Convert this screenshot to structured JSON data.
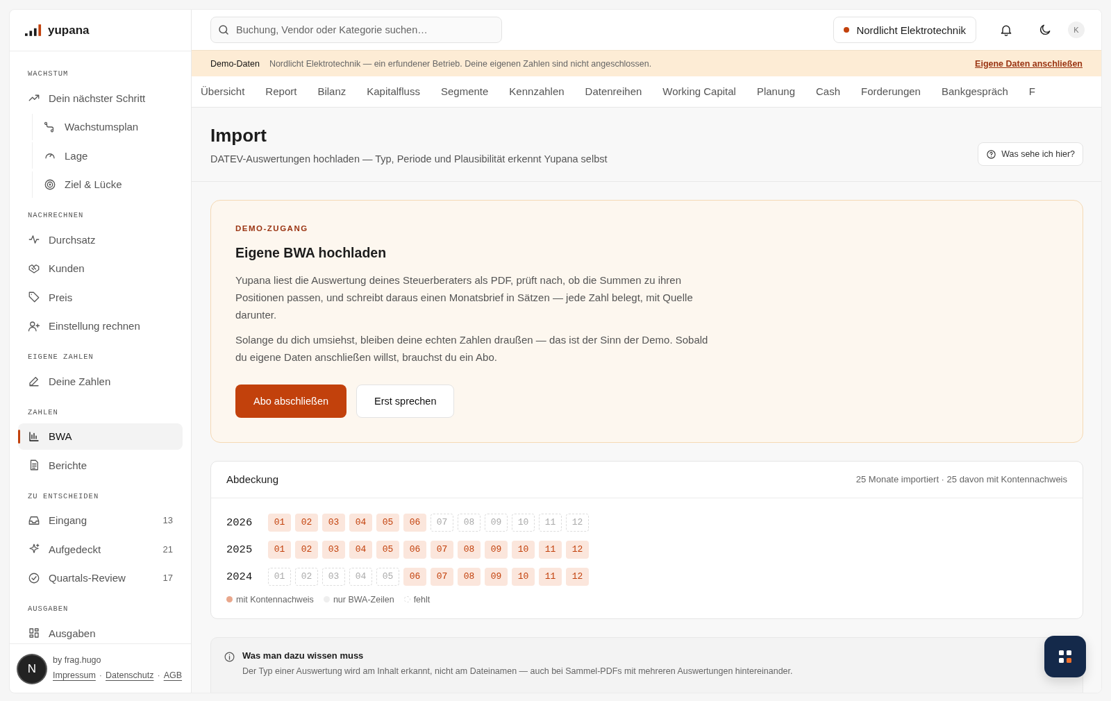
{
  "brand": {
    "name": "yupana"
  },
  "sidebar": {
    "sections": [
      {
        "title": "WACHSTUM",
        "items": [
          {
            "label": "Dein nächster Schritt",
            "selected": false,
            "children": [
              {
                "label": "Wachstumsplan",
                "selected": false
              },
              {
                "label": "Lage",
                "selected": false
              },
              {
                "label": "Ziel & Lücke",
                "selected": false
              }
            ]
          }
        ]
      },
      {
        "title": "NACHRECHNEN",
        "items": [
          {
            "label": "Durchsatz",
            "selected": false
          },
          {
            "label": "Kunden",
            "selected": false
          },
          {
            "label": "Preis",
            "selected": false
          },
          {
            "label": "Einstellung rechnen",
            "selected": false
          }
        ]
      },
      {
        "title": "EIGENE ZAHLEN",
        "items": [
          {
            "label": "Deine Zahlen",
            "selected": false
          }
        ]
      },
      {
        "title": "ZAHLEN",
        "items": [
          {
            "label": "BWA",
            "selected": true
          },
          {
            "label": "Berichte",
            "selected": false
          }
        ]
      },
      {
        "title": "ZU ENTSCHEIDEN",
        "items": [
          {
            "label": "Eingang",
            "selected": false,
            "count": "13"
          },
          {
            "label": "Aufgedeckt",
            "selected": false,
            "count": "21"
          },
          {
            "label": "Quartals-Review",
            "selected": false,
            "count": "17"
          }
        ]
      },
      {
        "title": "AUSGABEN",
        "items": [
          {
            "label": "Ausgaben",
            "selected": false
          }
        ]
      }
    ],
    "footer": {
      "credit": "by frag.hugo",
      "links": [
        "Impressum",
        "Datenschutz",
        "AGB"
      ],
      "separator": "·"
    }
  },
  "header": {
    "search": {
      "placeholder": "Buchung, Vendor oder Kategorie suchen…"
    },
    "company": {
      "name": "Nordlicht Elektrotechnik",
      "color": "#c2410c"
    },
    "avatar": "K"
  },
  "banner": {
    "label": "Demo-Daten",
    "text": "Nordlicht Elektrotechnik — ein erfundener Betrieb. Deine eigenen Zahlen sind nicht angeschlossen.",
    "link": "Eigene Daten anschließen"
  },
  "tabs": [
    {
      "label": "Übersicht",
      "selected": false
    },
    {
      "label": "Report",
      "selected": false
    },
    {
      "label": "Bilanz",
      "selected": false
    },
    {
      "label": "Kapitalfluss",
      "selected": false
    },
    {
      "label": "Segmente",
      "selected": false
    },
    {
      "label": "Kennzahlen",
      "selected": false
    },
    {
      "label": "Datenreihen",
      "selected": false
    },
    {
      "label": "Working Capital",
      "selected": false
    },
    {
      "label": "Planung",
      "selected": false
    },
    {
      "label": "Cash",
      "selected": false
    },
    {
      "label": "Forderungen",
      "selected": false
    },
    {
      "label": "Bankgespräch",
      "selected": false
    },
    {
      "label": "F",
      "selected": false
    }
  ],
  "page": {
    "title": "Import",
    "subtitle": "DATEV-Auswertungen hochladen — Typ, Periode und Plausibilität erkennt Yupana selbst",
    "help": "Was sehe ich hier?"
  },
  "demo_card": {
    "eyebrow": "DEMO-ZUGANG",
    "title": "Eigene BWA hochladen",
    "paragraphs": [
      "Yupana liest die Auswertung deines Steuerberaters als PDF, prüft nach, ob die Summen zu ihren Positionen passen, und schreibt daraus einen Monatsbrief in Sätzen — jede Zahl belegt, mit Quelle darunter.",
      "Solange du dich umsiehst, bleiben deine echten Zahlen draußen — das ist der Sinn der Demo. Sobald du eigene Daten anschließen willst, brauchst du ein Abo."
    ],
    "primary_button": "Abo abschließen",
    "secondary_button": "Erst sprechen"
  },
  "coverage": {
    "title": "Abdeckung",
    "summary": "25 Monate importiert · 25 davon mit Kontennachweis",
    "years": [
      {
        "year": "2026",
        "months": [
          {
            "label": "01",
            "kind": "konto"
          },
          {
            "label": "02",
            "kind": "konto"
          },
          {
            "label": "03",
            "kind": "konto"
          },
          {
            "label": "04",
            "kind": "konto"
          },
          {
            "label": "05",
            "kind": "konto"
          },
          {
            "label": "06",
            "kind": "konto"
          },
          {
            "label": "07",
            "kind": "fehlt"
          },
          {
            "label": "08",
            "kind": "fehlt"
          },
          {
            "label": "09",
            "kind": "fehlt"
          },
          {
            "label": "10",
            "kind": "fehlt"
          },
          {
            "label": "11",
            "kind": "fehlt"
          },
          {
            "label": "12",
            "kind": "fehlt"
          }
        ]
      },
      {
        "year": "2025",
        "months": [
          {
            "label": "01",
            "kind": "konto"
          },
          {
            "label": "02",
            "kind": "konto"
          },
          {
            "label": "03",
            "kind": "konto"
          },
          {
            "label": "04",
            "kind": "konto"
          },
          {
            "label": "05",
            "kind": "konto"
          },
          {
            "label": "06",
            "kind": "konto"
          },
          {
            "label": "07",
            "kind": "konto"
          },
          {
            "label": "08",
            "kind": "konto"
          },
          {
            "label": "09",
            "kind": "konto"
          },
          {
            "label": "10",
            "kind": "konto"
          },
          {
            "label": "11",
            "kind": "konto"
          },
          {
            "label": "12",
            "kind": "konto"
          }
        ]
      },
      {
        "year": "2024",
        "months": [
          {
            "label": "01",
            "kind": "fehlt"
          },
          {
            "label": "02",
            "kind": "fehlt"
          },
          {
            "label": "03",
            "kind": "fehlt"
          },
          {
            "label": "04",
            "kind": "fehlt"
          },
          {
            "label": "05",
            "kind": "fehlt"
          },
          {
            "label": "06",
            "kind": "konto"
          },
          {
            "label": "07",
            "kind": "konto"
          },
          {
            "label": "08",
            "kind": "konto"
          },
          {
            "label": "09",
            "kind": "konto"
          },
          {
            "label": "10",
            "kind": "konto"
          },
          {
            "label": "11",
            "kind": "konto"
          },
          {
            "label": "12",
            "kind": "konto"
          }
        ]
      }
    ],
    "legend": [
      {
        "label": "mit Kontennachweis",
        "kind": "konto"
      },
      {
        "label": "nur BWA-Zeilen",
        "kind": "bwa"
      },
      {
        "label": "fehlt",
        "kind": "fehlt"
      }
    ]
  },
  "info": {
    "title": "Was man dazu wissen muss",
    "text": "Der Typ einer Auswertung wird am Inhalt erkannt, nicht am Dateinamen — auch bei Sammel-PDFs mit mehreren Auswertungen hintereinander."
  },
  "dev_badge": "N"
}
